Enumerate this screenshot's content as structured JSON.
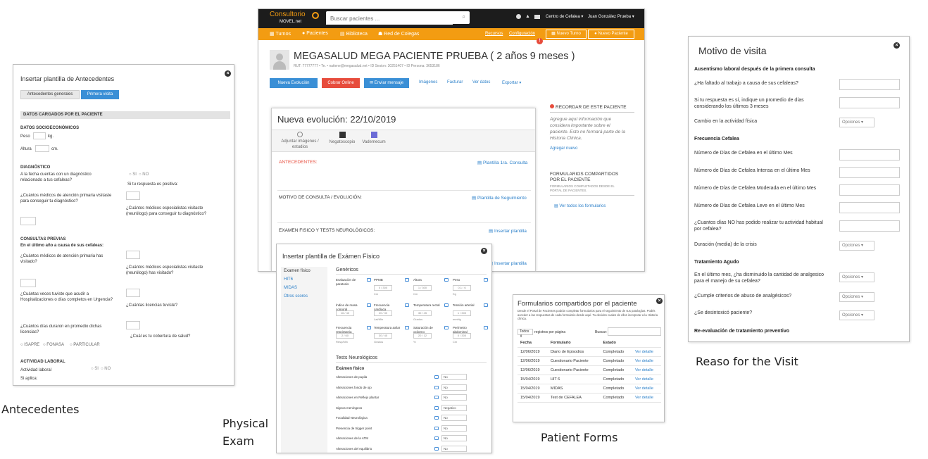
{
  "captions": {
    "antecedentes": "Antecedentes",
    "physical": "Physical",
    "exam": "Exam",
    "patient_forms": "Patient Forms",
    "reason": "Reaso for the Visit"
  },
  "antecedentes": {
    "title": "Insertar plantilla de Antecedentes",
    "tabs": [
      "Antecedentes generales",
      "Primera visita"
    ],
    "section_header": "DATOS CARGADOS POR EL PACIENTE",
    "socio_title": "DATOS SOCIOECONÓMICOS",
    "peso": "Peso",
    "kg": "kg.",
    "altura": "Altura",
    "cm": "cm.",
    "diag_title": "DIAGNÓSTICO",
    "diag_q1": "A la fecha cuentas con un diagnóstico relacionado a tus cefaleas?",
    "si": "SI",
    "no": "NO",
    "si_positiva": "Si tu respuesta es positiva:",
    "diag_q2": "¿Cuántos médicos de atención primaria visitaste para conseguir tu diagnóstico?",
    "diag_q3": "¿Cuántos médicos especialistas visitaste (neurólogo) para conseguir tu diagnóstico?",
    "consultas_title": "CONSULTAS PREVIAS",
    "consultas_sub": "En el último año a causa de sus cefaleas:",
    "cq1": "¿Cuántos médicos de atención primaria has visitado?",
    "cq2": "¿Cuántos médicos especialistas visitaste (neurólogo) has visitado?",
    "cq3": "¿Cuántas veces tuviste que acudir a Hospitalizaciones o días completos en Urgencia?",
    "cq4": "¿Cuántas licencias tuviste?",
    "cq5": "¿Cuántos días duraron en promedio dichas licencias?",
    "cq6": "¿Cuál es tu cobertura de salud?",
    "coberturas": [
      "ISAPRE",
      "FONASA",
      "PARTICULAR"
    ],
    "laboral_title": "ACTIVIDAD LABORAL",
    "laboral_q": "Actividad laboral",
    "si_aplica": "Si aplica:"
  },
  "app": {
    "logo_line1": "Consultorio",
    "logo_line2": "MOVEL.net",
    "search_placeholder": "Buscar pacientes ...",
    "center": "Centro de Cefalea ▾",
    "user": "Juan González Prueba ▾",
    "nav": [
      "Turnos",
      "Pacientes",
      "Biblioteca",
      "Red de Colegas"
    ],
    "nav_right": [
      "Recursos",
      "Configuración"
    ],
    "nuevo_turno": "Nuevo Turno",
    "nuevo_paciente": "Nuevo Paciente",
    "badge": "!",
    "patient_name": "MEGASALUD MEGA PACIENTE PRUEBA ( 2 años 9 meses )",
    "patient_meta": "RUT: 77777777 • Te. • natiene@megasalud.net • ID Sesion: 30251407 • ID Persona: 3653186",
    "actions": [
      "Nueva Evolución",
      "Cobrar Online",
      "Enviar mensaje"
    ],
    "links": [
      "Imágenes",
      "Facturar",
      "Ver datos",
      "Exportar ▾"
    ],
    "evo_title": "Nueva evolución: 22/10/2019",
    "evo_tools": [
      "Adjuntar imágenes / estudios",
      "Negatoscopio",
      "Vademecum"
    ],
    "antecedentes_label": "ANTECEDENTES:",
    "plantilla1": "Plantilla 1ra. Consulta",
    "motivo_label": "MOTIVO DE CONSULTA / EVOLUCIÓN:",
    "plantilla2": "Plantilla de Seguimiento",
    "examen_label": "EXAMEN FISICO Y TESTS NEUROLÓGICOS:",
    "plantilla3": "Insertar plantilla",
    "plantilla4": "Insertar plantilla",
    "recordar_title": "RECORDAR DE ESTE PACIENTE",
    "recordar_text": "Agregue aquí información que considera importante sobre el paciente. Esto no formará parte de la Historia Clínica.",
    "agregar": "Agregar nuevo",
    "formularios_title": "FORMULARIOS COMPARTIDOS POR EL PACIENTE",
    "formularios_sub": "FORMULARIOS COMPLETADOS DESDE EL PORTAL DE PACIENTES.",
    "ver_todos": "Ver todos los formularios"
  },
  "physical": {
    "title": "Insertar plantilla de Exámen Físico",
    "side": [
      "Examen físico",
      "HIT6",
      "MIDAS",
      "Otros scores"
    ],
    "genericos": "Genéricos",
    "fields": [
      {
        "label": "Evaluación de paratosis",
        "value": "",
        "unit": ""
      },
      {
        "label": "PPMB",
        "value": "0 / 300",
        "unit": "Cm"
      },
      {
        "label": "Altura",
        "value": "1 / 300",
        "unit": "Cm"
      },
      {
        "label": "Peso",
        "value": "0.1 / 6",
        "unit": "Kg"
      },
      {
        "label": "Índice de masa corporal",
        "value": "16 / 40",
        "unit": ""
      },
      {
        "label": "Frecuencia cardíaca",
        "value": "20 / 30",
        "unit": "Lat/Min"
      },
      {
        "label": "Temperatura rectal",
        "value": "30 / 45",
        "unit": "Grados"
      },
      {
        "label": "Tensión arterial",
        "value": "1 / 300",
        "unit": "mmHg"
      },
      {
        "label": "Frecuencia respiratoria",
        "value": "2 / 60",
        "unit": "Resp/Min"
      },
      {
        "label": "Temperatura axilar",
        "value": "30 / 45",
        "unit": "Grados"
      },
      {
        "label": "Saturación de oxígeno",
        "value": "20 / 12",
        "unit": "%"
      },
      {
        "label": "Perímetro abdominal",
        "value": "0 / 300",
        "unit": "Cm"
      }
    ],
    "tests_title": "Tests Neurológicos",
    "examen_fisico": "Exámen físico",
    "tests": [
      {
        "label": "Alteraciones de pupila",
        "value": "No"
      },
      {
        "label": "Alteraciones fondo de ojo",
        "value": "No"
      },
      {
        "label": "Alteraciones en Reflejo plantar",
        "value": "No"
      },
      {
        "label": "Signos meníngeos",
        "value": "Negativo"
      },
      {
        "label": "Focalidad Neurológica",
        "value": "No"
      },
      {
        "label": "Presencia de trigger point",
        "value": "No"
      },
      {
        "label": "Alteraciones de la ATM",
        "value": "No"
      },
      {
        "label": "Alteraciones del equilibrio",
        "value": "No"
      },
      {
        "label": "Otros",
        "value": ""
      }
    ]
  },
  "forms": {
    "title": "Formularios compartidos por el paciente",
    "desc": "Desde el Portal de Pacientes podrán completar formularios para el seguimiento de sus patologías. Podés acceder a las respuestas de cada formulario desde aquí. Tu decides cuales de ellos incorporar a la Historia clínica.",
    "show_label": "Todos",
    "per_page": "registros por página",
    "buscar": "Buscar:",
    "columns": [
      "Fecha",
      "Formulario",
      "Estado",
      ""
    ],
    "rows": [
      [
        "12/06/2019",
        "Diario de Episodios",
        "Completado",
        "Ver detalle"
      ],
      [
        "12/06/2019",
        "Cuestionario Paciente",
        "Completado",
        "Ver detalle"
      ],
      [
        "12/06/2019",
        "Cuestionario Paciente",
        "Completado",
        "Ver detalle"
      ],
      [
        "15/04/2019",
        "HIT 6",
        "Completado",
        "Ver detalle"
      ],
      [
        "15/04/2019",
        "MIDAS",
        "Completado",
        "Ver detalle"
      ],
      [
        "15/04/2019",
        "Test de CEFALEA",
        "Completado",
        "Ver detalle"
      ]
    ]
  },
  "motivo": {
    "title": "Motivo de visita",
    "h1": "Ausentismo laboral después de la primera consulta",
    "q1": "¿Ha faltado al trabajo a causa de sus cefaleas?",
    "q2": "Si tu respuesta es sí, indique un promedio de días considerando los últimos 3 meses",
    "q3": "Cambio en la actividad física",
    "h2": "Frecuencia Cefalea",
    "q4": "Número de Días de Cefalea en el último Mes",
    "q5": "Número de Días de Cefalea Intensa en el último Mes",
    "q6": "Número de Días de Cefalea Moderada en el último Mes",
    "q7": "Número de Días de Cefalea Leve en el último Mes",
    "q8": "¿Cuantos días NO has podido realizar tu actividad habitual por cefalea?",
    "q9": "Duración (media) de la crisis",
    "h3": "Tratamiento Agudo",
    "q10": "En el último mes, ¿ha disminuido la cantidad de analgesico para el manejo de su cefalea?",
    "q11": "¿Cumple criterios de abuso de analgésicos?",
    "q12": "¿Se desintoxicó paciente?",
    "h4": "Re-evaluación de tratamiento preventivo",
    "opciones": "Opciones ▾"
  },
  "colors": {
    "orange": "#f39c12",
    "dark": "#1c1c1c",
    "blue": "#3a8fd6",
    "red": "#e74c3c",
    "link": "#2a7fc9"
  }
}
